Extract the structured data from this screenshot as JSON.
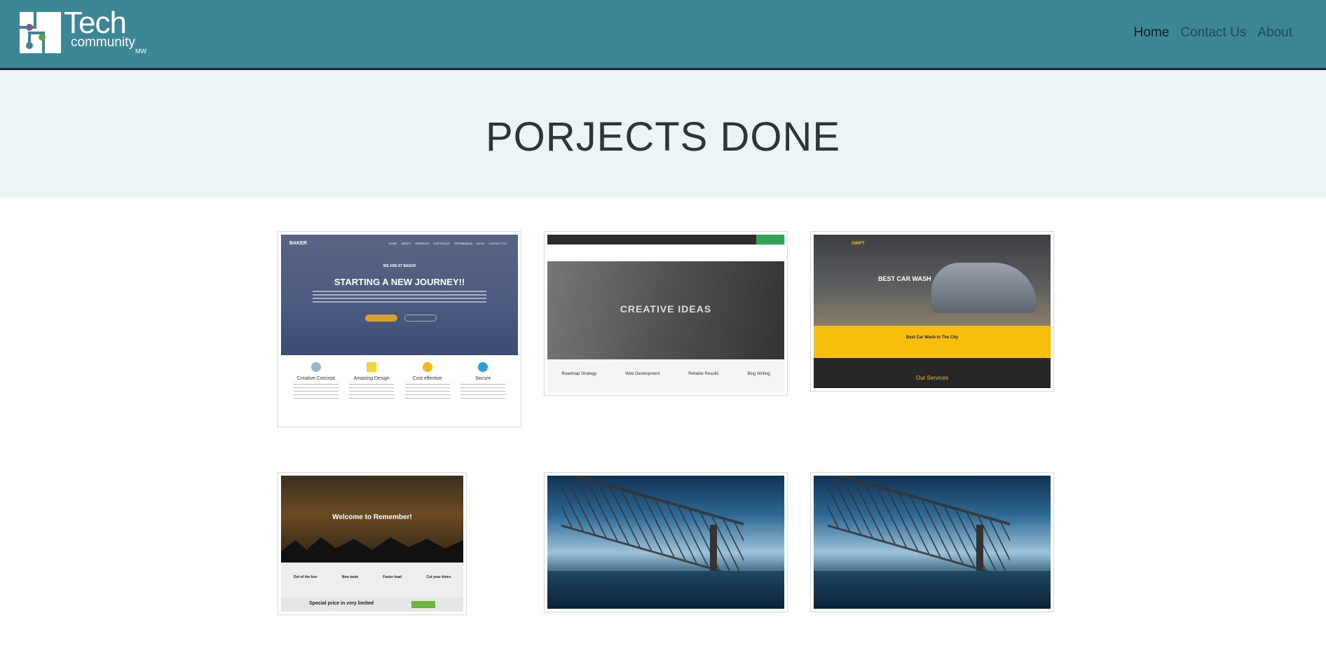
{
  "header": {
    "logo": {
      "line1": "Tech",
      "line2": "community",
      "line3": "MW"
    },
    "nav": [
      {
        "label": "Home"
      },
      {
        "label": "Contact Us"
      },
      {
        "label": "About"
      }
    ]
  },
  "hero": {
    "title": "PORJECTS DONE"
  },
  "projects": [
    {
      "name": "baker",
      "brand": "BAKER",
      "menu": [
        "HOME",
        "ABOUT",
        "SERVICES",
        "PORTFOLIO",
        "TESTIMONIAL",
        "BLOG",
        "CONTACT US"
      ],
      "kicker": "WE ARE AT BAKER",
      "headline": "STARTING A NEW JOURNEY!!",
      "features": [
        {
          "label": "Creative Concept",
          "color": "#9fb7c7"
        },
        {
          "label": "Amazing Design",
          "color": "#f4d53c"
        },
        {
          "label": "Cost effective",
          "color": "#f1b71e"
        },
        {
          "label": "Secure",
          "color": "#27a1d8"
        }
      ]
    },
    {
      "name": "creative-ideas",
      "headline": "CREATIVE IDEAS",
      "features": [
        "Roadmap Strategy",
        "Web Development",
        "Reliable Results",
        "Blog Writing"
      ]
    },
    {
      "name": "car-wash",
      "brand": "SWIFT",
      "headline": "BEST CAR WASH",
      "band": "Best Car Wash In The City",
      "services": "Our Services"
    },
    {
      "name": "remember",
      "headline": "Welcome to Remember!",
      "features": [
        "Out of the box",
        "New taste",
        "Faster load",
        "Cut your times"
      ],
      "bottom": "Special price in very limited"
    },
    {
      "name": "bridge-1"
    },
    {
      "name": "bridge-2"
    }
  ]
}
